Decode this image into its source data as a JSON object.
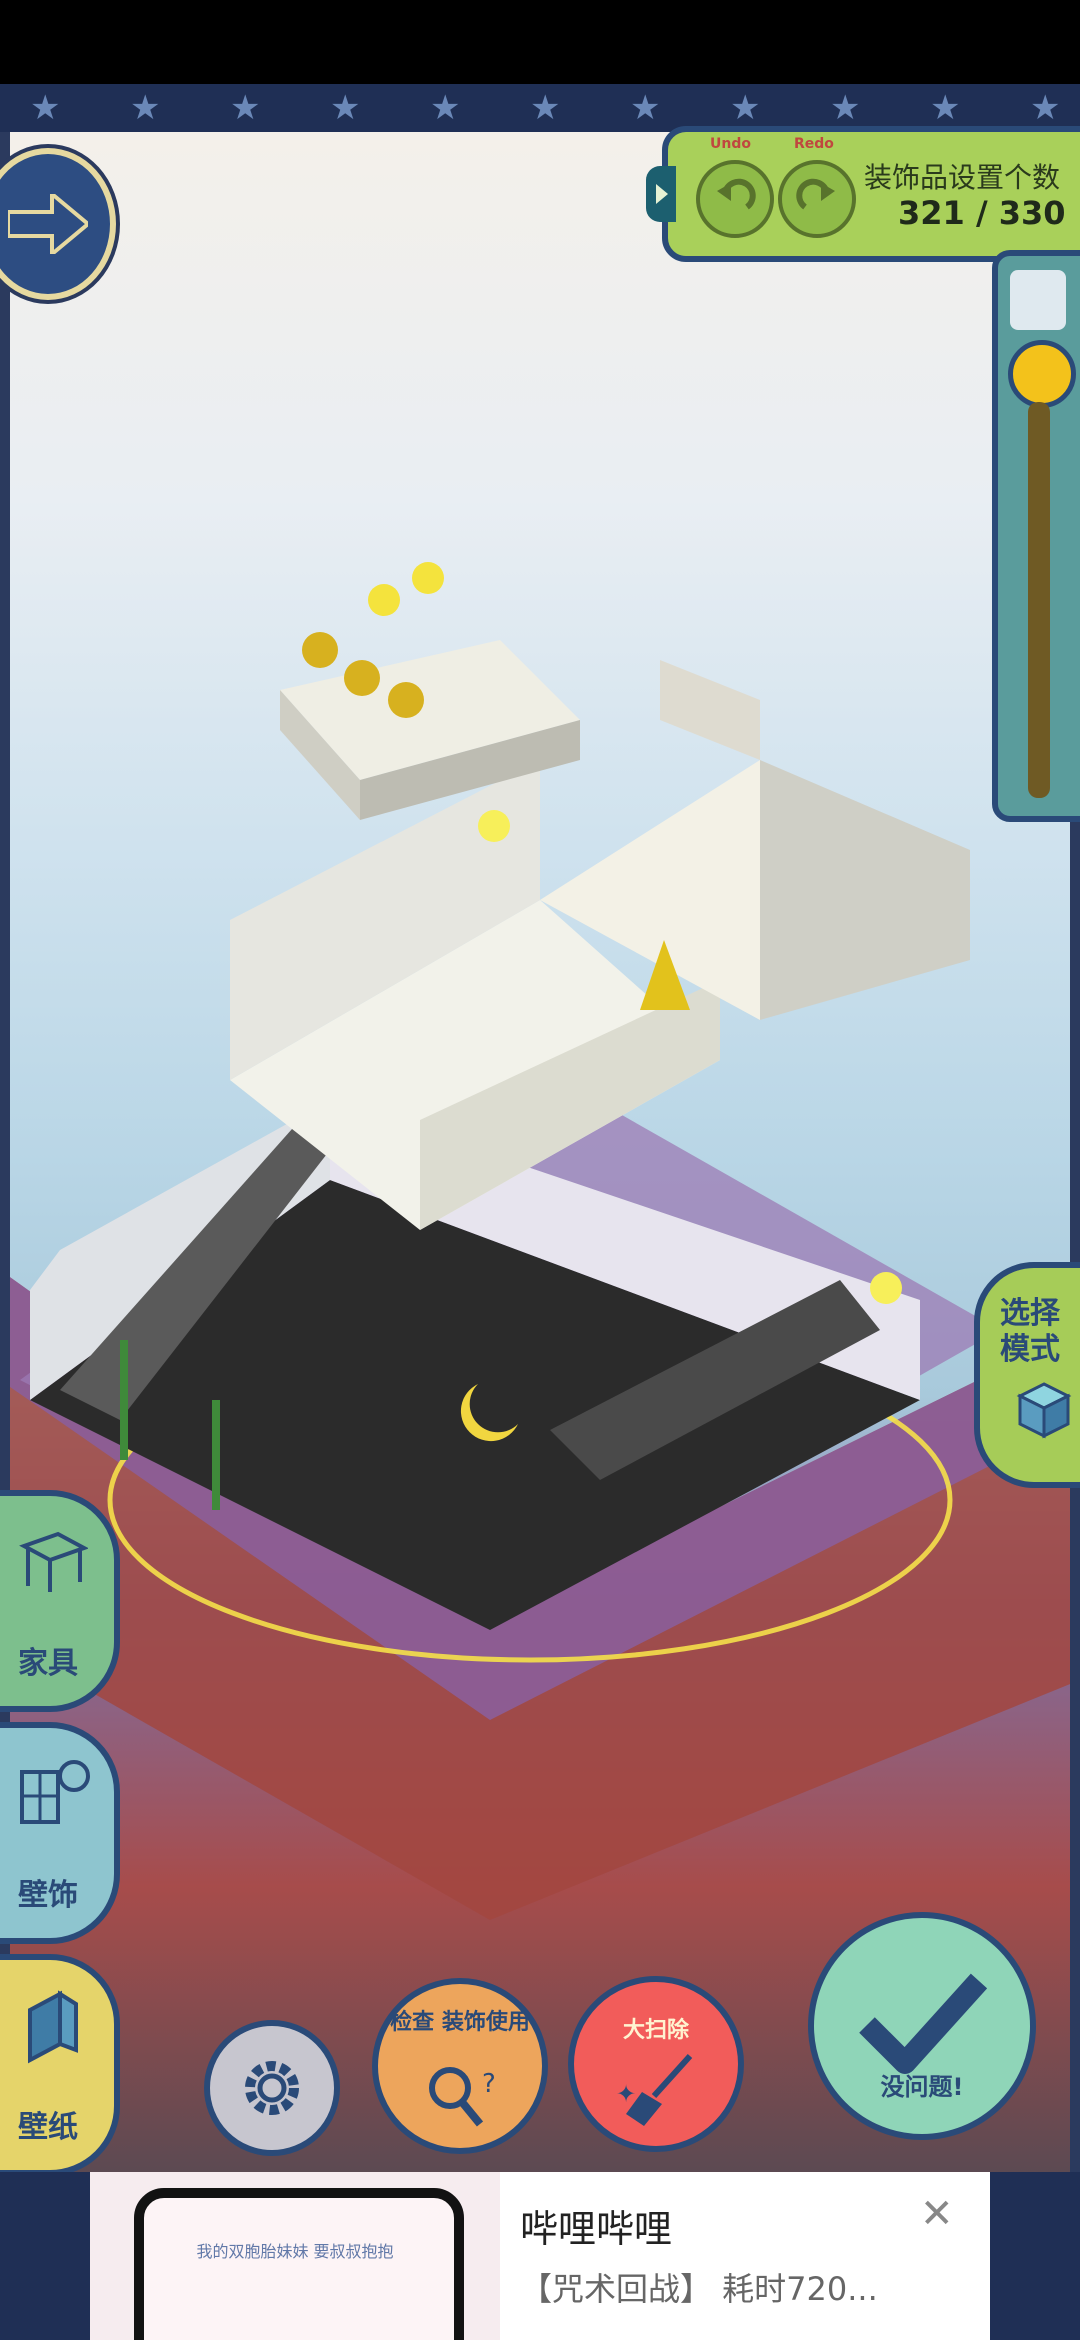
{
  "toolbar": {
    "undo_label": "Undo",
    "redo_label": "Redo",
    "counter_title": "装饰品设置个数",
    "counter_value": "321 / 330"
  },
  "mode": {
    "label": "选择模式"
  },
  "categories": [
    {
      "label": "家具",
      "icon": "table-icon"
    },
    {
      "label": "壁饰",
      "icon": "window-clock-icon"
    },
    {
      "label": "壁纸",
      "icon": "wallpaper-icon"
    }
  ],
  "actions": {
    "detail_label": "检查 装饰使用",
    "cleanup_label": "大扫除",
    "confirm_label": "没问题!"
  },
  "ad": {
    "title": "哔哩哔哩",
    "subtitle": "【咒术回战】 耗时720...",
    "thumb_text": "我的双胞胎妹妹 要叔叔抱抱"
  },
  "colors": {
    "panel_green": "#a9d05a",
    "frame_navy": "#2a4a78",
    "knob_yellow": "#f3c21b"
  }
}
